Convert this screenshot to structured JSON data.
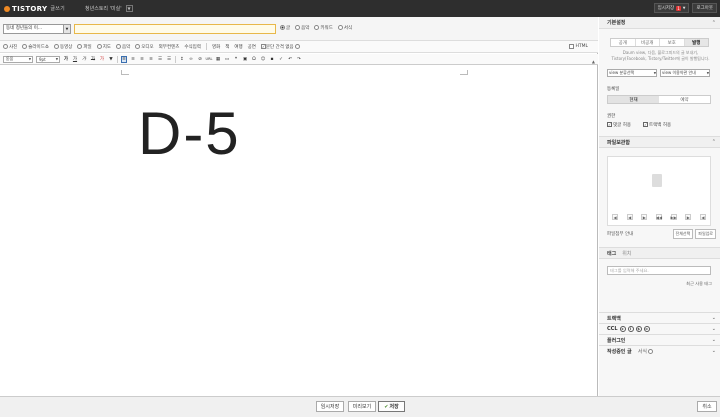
{
  "topbar": {
    "logo": "TISTORY",
    "logo_sub": "글쓰기",
    "blog_name": "청년스토리 '미실'",
    "draft_label": "임시저장",
    "draft_count": "1",
    "logout_label": "로그아웃"
  },
  "editor": {
    "category": "동네 청년들의 이...",
    "title_value": "",
    "post_types": [
      {
        "label": "글",
        "selected": true
      },
      {
        "label": "음악",
        "selected": false
      },
      {
        "label": "키워드",
        "selected": false
      },
      {
        "label": "서식",
        "selected": false
      }
    ],
    "insert_items": [
      "사진",
      "슬라이드쇼",
      "동영상",
      "파일",
      "지도",
      "음악",
      "오디오",
      "외부컨텐츠",
      "수식입력",
      "영화",
      "책",
      "이행",
      "공연",
      "문단 간격 없음"
    ],
    "embed_items": [
      "영화",
      "책",
      "여행",
      "공연"
    ],
    "no_spacing_label": "문단 간격 없음",
    "html_label": "HTML",
    "font_family": "돋움",
    "font_size": "9pt",
    "format_buttons": [
      "가",
      "가",
      "가",
      "가",
      "가"
    ],
    "content_text": "D-5"
  },
  "bottom": {
    "draft_button": "임시저장",
    "preview_button": "미리보기",
    "save_button": "저장",
    "close_button": "취소"
  },
  "sidebar": {
    "basic_settings_title": "기본설정",
    "visibility_tabs": [
      {
        "label": "공개",
        "active": false
      },
      {
        "label": "비공개",
        "active": false
      },
      {
        "label": "보호",
        "active": false
      },
      {
        "label": "발행",
        "active": true
      }
    ],
    "visibility_note": "Daum view, 다음, 블로그피드의 글 보내기, Tistory(Facebook, Tistory/Twitter에 글이 발행됩니다.",
    "view_select_1": "view 분류선택",
    "view_select_2": "view 이용약관 안내",
    "register_label": "등록일",
    "register_options": [
      {
        "label": "현재",
        "active": true
      },
      {
        "label": "예약",
        "active": false
      }
    ],
    "permission_label": "권한",
    "allow_comment": "댓글 허용",
    "allow_trackback": "트랙백 허용",
    "file_title": "파일보관함",
    "file_nav": [
      "◀",
      "◀",
      "▶",
      "◀◀",
      "▶▶",
      "▶",
      "◀"
    ],
    "file_guide": "파일첨부 안내",
    "file_select_all": "전체선택",
    "file_upload": "파일업로",
    "tag_tab": "태그",
    "location_tab": "위치",
    "tag_placeholder": "태그를 입력해 주세요.",
    "recent_tags": "최근 사용 태그",
    "trackback_title": "트랙백",
    "ccl_title": "CCL",
    "plugin_title": "플러그인",
    "recent_posts_title": "작성중인 글",
    "recent_posts_sub": "서식"
  }
}
